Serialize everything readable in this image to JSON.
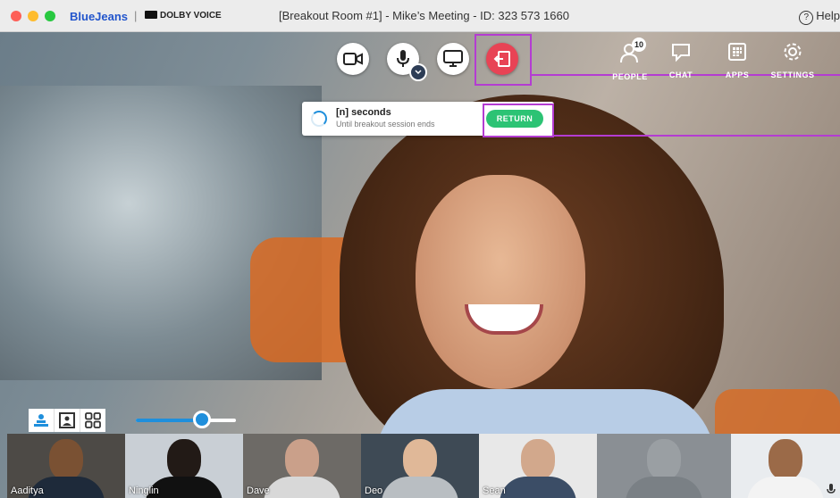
{
  "titlebar": {
    "brand": "BlueJeans",
    "separator": "|",
    "partner": "DOLBY VOICE",
    "title": "[Breakout Room #1] - Mike’s Meeting - ID: 323 573 1660",
    "help": "Help",
    "help_mark": "?"
  },
  "controls": {
    "camera_icon": "video-camera-icon",
    "mic_icon": "microphone-icon",
    "screenshare_icon": "screen-share-icon",
    "leave_icon": "leave-breakout-icon"
  },
  "topnav": {
    "people": "PEOPLE",
    "people_count": "10",
    "chat": "CHAT",
    "apps": "APPS",
    "settings": "SETTINGS"
  },
  "notice": {
    "title": "[n] seconds",
    "subtitle": "Until breakout session ends",
    "button": "RETURN"
  },
  "colors": {
    "accent_blue": "#1f8fdc",
    "leave_red": "#e84355",
    "return_green": "#2cc374",
    "highlight_purple": "#b43cd2"
  },
  "volume_level": 0.66,
  "participants": [
    {
      "name": "Aaditya"
    },
    {
      "name": "Ninglin"
    },
    {
      "name": "Dave"
    },
    {
      "name": "Deo"
    },
    {
      "name": "Sean"
    },
    {
      "name": ""
    },
    {
      "name": ""
    }
  ]
}
